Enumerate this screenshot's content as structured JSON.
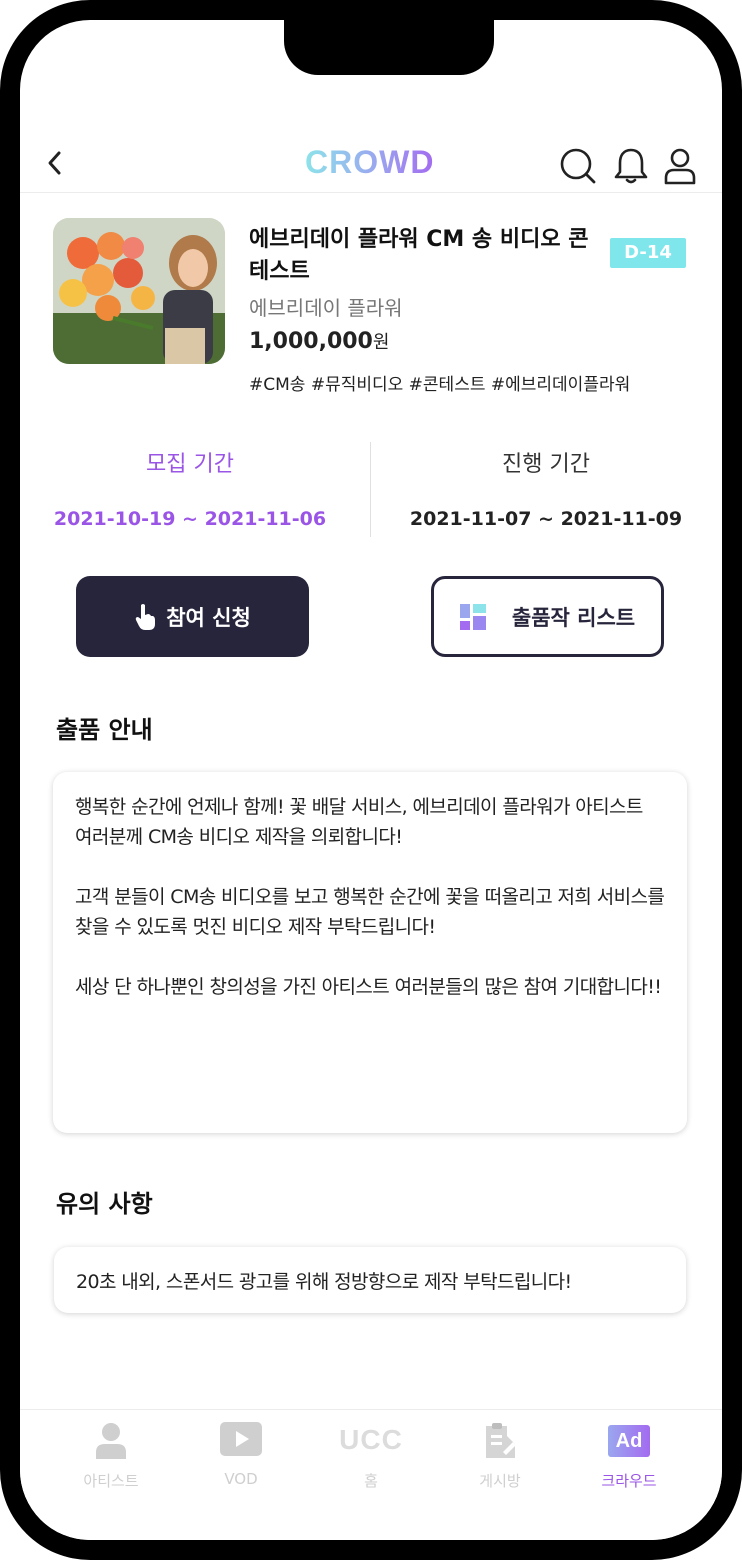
{
  "header": {
    "logo": "CROWD"
  },
  "contest": {
    "title": "에브리데이 플라워 CM 송 비디오 콘테스트",
    "dday": "D-14",
    "sponsor": "에브리데이 플라워",
    "prize_amount": "1,000,000",
    "prize_unit": "원",
    "tags": "#CM송 #뮤직비디오 #콘테스트 #에브리데이플라워"
  },
  "periods": {
    "recruit_label": "모집 기간",
    "recruit_dates": "2021-10-19 ~ 2021-11-06",
    "run_label": "진행 기간",
    "run_dates": "2021-11-07 ~ 2021-11-09"
  },
  "buttons": {
    "apply": "참여 신청",
    "entries": "출품작 리스트"
  },
  "guide": {
    "title": "출품 안내",
    "paragraphs": [
      "행복한 순간에 언제나 함께! 꽃 배달 서비스, 에브리데이 플라워가 아티스트 여러분께 CM송 비디오 제작을 의뢰합니다!",
      "고객 분들이 CM송 비디오를 보고 행복한 순간에 꽃을 떠올리고 저희 서비스를 찾을 수 있도록 멋진 비디오 제작 부탁드립니다!",
      "세상 단 하나뿐인 창의성을 가진 아티스트 여러분들의 많은 참여 기대합니다!!"
    ]
  },
  "notes": {
    "title": "유의 사항",
    "text": "20초 내외, 스폰서드 광고를 위해 정방향으로 제작 부탁드립니다!"
  },
  "bottom_nav": {
    "items": [
      {
        "label": "아티스트",
        "icon": "person-icon"
      },
      {
        "label": "VOD",
        "icon": "play-icon"
      },
      {
        "label": "홈",
        "icon": "ucc-icon",
        "icon_text": "UCC"
      },
      {
        "label": "게시방",
        "icon": "board-icon"
      },
      {
        "label": "크라우드",
        "icon": "ad-icon",
        "icon_text": "Ad",
        "active": true
      }
    ]
  },
  "colors": {
    "accent_purple": "#9a54e6",
    "accent_cyan": "#7fe7ec",
    "dark_button": "#27253b"
  }
}
